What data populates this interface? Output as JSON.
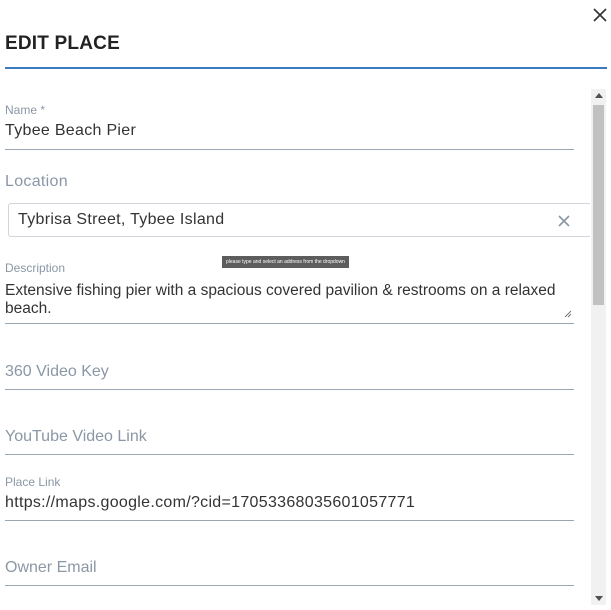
{
  "dialog": {
    "title": "EDIT PLACE",
    "close_icon": "close-icon"
  },
  "fields": {
    "name": {
      "label": "Name  *",
      "value": "Tybee Beach Pier"
    },
    "location": {
      "label": "Location",
      "value": "Tybrisa Street, Tybee Island",
      "clear_icon": "clear-icon",
      "tooltip": "please type and select an address from the dropdown"
    },
    "description": {
      "label": "Description",
      "value": "Extensive fishing pier with a spacious covered pavilion & restrooms on a relaxed beach."
    },
    "video_360": {
      "placeholder": "360 Video Key"
    },
    "youtube": {
      "placeholder": "YouTube Video Link"
    },
    "place_link": {
      "label": "Place Link",
      "value": "https://maps.google.com/?cid=17053368035601057771"
    },
    "owner_email": {
      "placeholder": "Owner Email"
    }
  },
  "colors": {
    "accent": "#3b7bbf",
    "muted_text": "#8a97a5",
    "underline": "#9aa6b2"
  }
}
